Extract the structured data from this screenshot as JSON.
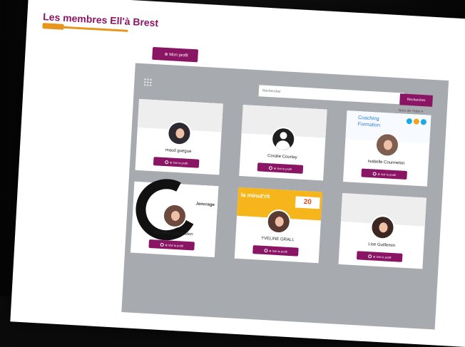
{
  "page": {
    "title": "Les membres Ell'à Brest"
  },
  "actions": {
    "profile": "⊕ Mon profil"
  },
  "search": {
    "placeholder": "Rechercher",
    "button": "Rechercher"
  },
  "sort": {
    "label": "Nom de l'hôte ▾"
  },
  "members": [
    {
      "name": "maud guegue",
      "button": "⊕ Voir le profil",
      "avatar": "photo",
      "banner": "plain"
    },
    {
      "name": "Coralie Courtay",
      "button": "⊕ Voir le profil",
      "avatar": "silhouette",
      "banner": "plain"
    },
    {
      "name": "Isabelle Courmelon",
      "button": "⊕ Voir le profil",
      "avatar": "photo",
      "banner": "coaching"
    },
    {
      "name": "Nolwenn Courmelon",
      "button": "⊕ Voir le profil",
      "avatar": "photo",
      "banner": "brand"
    },
    {
      "name": "YVELINE GRALL",
      "button": "⊕ Voir le profil",
      "avatar": "photo",
      "banner": "minuterie"
    },
    {
      "name": "Lise Guillemin",
      "button": "⊕ Voir le profil",
      "avatar": "photo",
      "banner": "plain"
    }
  ],
  "banners": {
    "coaching_line1": "Coaching",
    "coaching_line2": "Formation",
    "brand": "Jencrage",
    "minuterie": "la minut'rit",
    "year": "20"
  }
}
